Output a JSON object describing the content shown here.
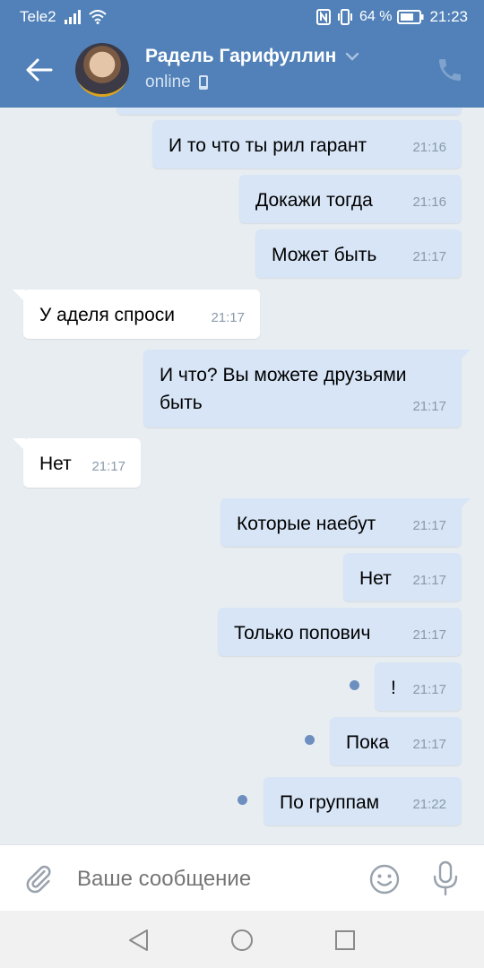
{
  "status_bar": {
    "carrier": "Tele2",
    "battery_percent": "64 %",
    "time": "21:23",
    "icons": [
      "signal-icon",
      "wifi-icon",
      "nfc-icon",
      "vibrate-icon",
      "battery-icon"
    ]
  },
  "header": {
    "contact_name": "Радель Гарифуллин",
    "status": "online",
    "icons": [
      "back-arrow-icon",
      "chevron-down-icon",
      "mobile-device-icon",
      "phone-call-icon"
    ]
  },
  "messages": [
    {
      "dir": "out",
      "text": "И то что ты рил гарант",
      "time": "21:16"
    },
    {
      "dir": "out",
      "text": "Докажи тогда",
      "time": "21:16"
    },
    {
      "dir": "out",
      "text": "Может быть",
      "time": "21:17"
    },
    {
      "dir": "in",
      "text": "У аделя спроси",
      "time": "21:17"
    },
    {
      "dir": "out",
      "text": "И что? Вы можете друзьями быть",
      "time": "21:17"
    },
    {
      "dir": "in",
      "text": "Нет",
      "time": "21:17"
    },
    {
      "dir": "out",
      "text": "Которые наебут",
      "time": "21:17"
    },
    {
      "dir": "out",
      "text": "Нет",
      "time": "21:17"
    },
    {
      "dir": "out",
      "text": "Только попович",
      "time": "21:17"
    },
    {
      "dir": "out",
      "text": "!",
      "time": "21:17",
      "unread": true
    },
    {
      "dir": "out",
      "text": "Пока",
      "time": "21:17",
      "unread": true
    },
    {
      "dir": "out",
      "text": "По группам",
      "time": "21:22",
      "unread": true
    }
  ],
  "composer": {
    "placeholder": "Ваше сообщение",
    "icons": [
      "paperclip-icon",
      "emoji-icon",
      "microphone-icon"
    ]
  },
  "nav_bar": {
    "icons": [
      "nav-back-icon",
      "nav-home-icon",
      "nav-recents-icon"
    ]
  },
  "colors": {
    "header_bg": "#5181b8",
    "outgoing_bubble": "#d7e5f6",
    "incoming_bubble": "#ffffff",
    "chat_bg": "#e8edf2",
    "unread_dot": "#6c8fbf"
  }
}
